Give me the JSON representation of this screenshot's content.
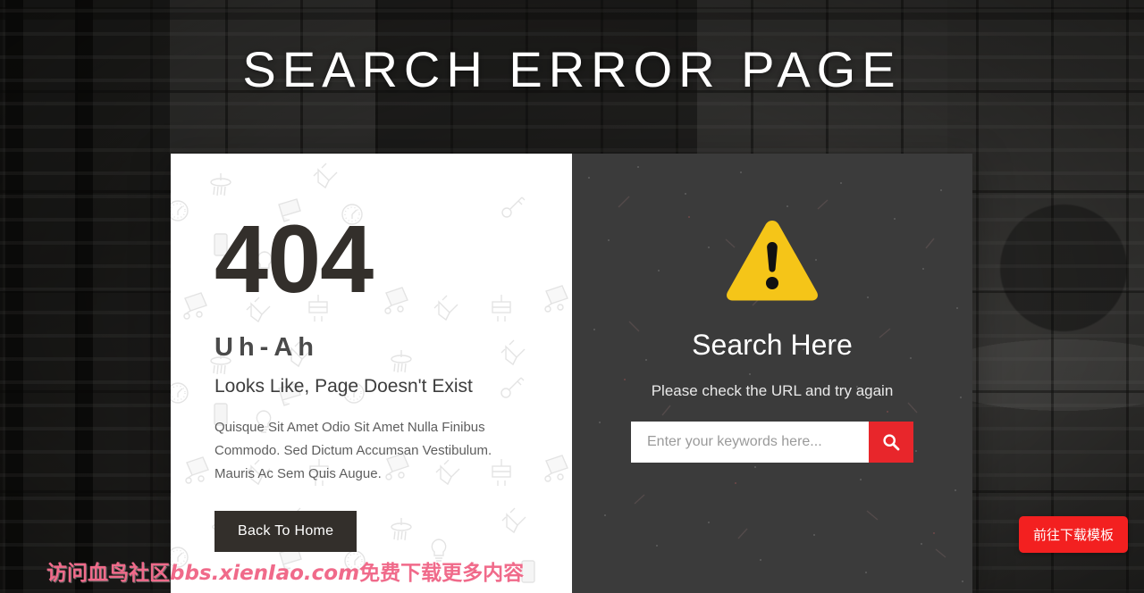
{
  "header": {
    "title": "SEARCH ERROR PAGE"
  },
  "left_panel": {
    "error_code": "404",
    "heading": "Uh-Ah",
    "subheading": "Looks Like, Page Doesn't Exist",
    "description": "Quisque Sit Amet Odio Sit Amet Nulla Finibus Commodo. Sed Dictum Accumsan Vestibulum. Mauris Ac Sem Quis Augue.",
    "back_button_label": "Back To Home",
    "background_pattern_icons": [
      "shower-head-icon",
      "trowel-icon",
      "megaphone-icon",
      "clock-icon",
      "smartphone-icon",
      "lightbulb-icon",
      "key-icon",
      "wheelbarrow-icon",
      "paint-brush-icon",
      "paint-roller-icon"
    ]
  },
  "right_panel": {
    "warning_icon": "warning-triangle-icon",
    "title": "Search Here",
    "subtitle": "Please check the URL and try again",
    "search": {
      "placeholder": "Enter your keywords here...",
      "value": "",
      "submit_icon": "search-icon"
    }
  },
  "watermark": {
    "text_cn_prefix": "访问血鸟社区",
    "text_latin": "bbs.xienIao.com",
    "text_cn_suffix": "免费下载更多内容"
  },
  "cta": {
    "label": "前往下载模板"
  },
  "colors": {
    "accent_red": "#e8262b",
    "cta_red": "#f32020",
    "warning_yellow": "#f5c518",
    "dark_panel": "#3b3b3b",
    "dark_text": "#332f2b",
    "watermark_pink": "#f06a8a"
  }
}
